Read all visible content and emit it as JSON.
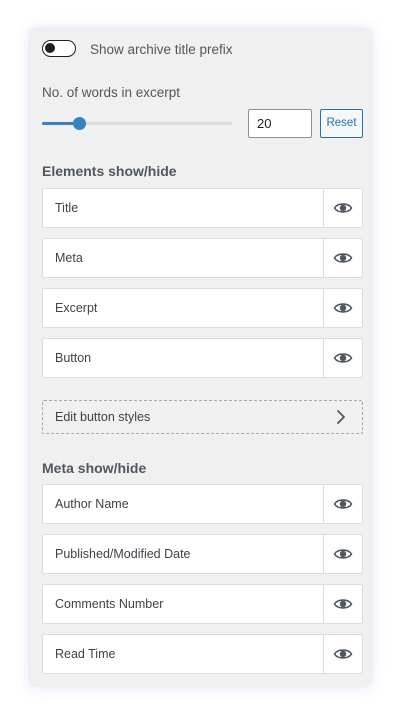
{
  "archive_prefix": {
    "label": "Show archive title prefix",
    "enabled": false
  },
  "excerpt": {
    "label": "No. of words in excerpt",
    "value": "20",
    "slider_fraction": 0.2,
    "reset_label": "Reset"
  },
  "elements": {
    "heading": "Elements show/hide",
    "items": [
      {
        "label": "Title",
        "icon": "eye-icon",
        "visible": true
      },
      {
        "label": "Meta",
        "icon": "eye-icon",
        "visible": true
      },
      {
        "label": "Excerpt",
        "icon": "eye-icon",
        "visible": true
      },
      {
        "label": "Button",
        "icon": "eye-icon",
        "visible": true
      }
    ]
  },
  "button_styles": {
    "label": "Edit button styles",
    "icon": "chevron-right-icon"
  },
  "meta": {
    "heading": "Meta show/hide",
    "items": [
      {
        "label": "Author Name",
        "icon": "eye-icon",
        "visible": true
      },
      {
        "label": "Published/Modified Date",
        "icon": "eye-icon",
        "visible": true
      },
      {
        "label": "Comments Number",
        "icon": "eye-icon",
        "visible": true
      },
      {
        "label": "Read Time",
        "icon": "eye-icon",
        "visible": true
      }
    ]
  },
  "colors": {
    "panel_bg": "#f0f0f1",
    "accent": "#3582c4",
    "button_blue": "#2271b1",
    "toggle_dark": "#1e1e1e",
    "text": "#3c434a"
  }
}
